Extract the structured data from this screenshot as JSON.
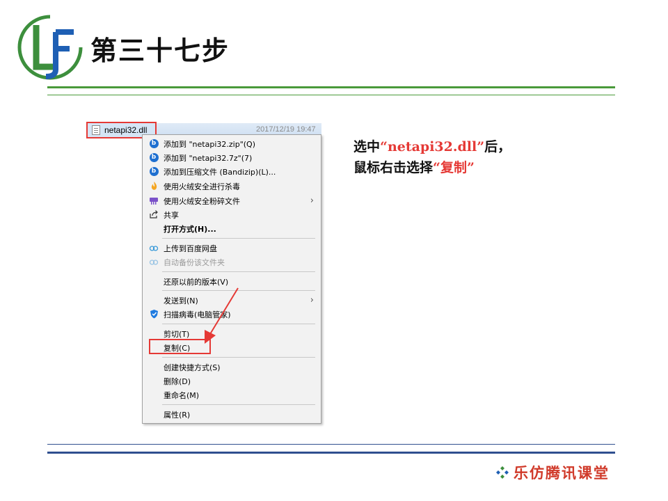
{
  "slide": {
    "title": "第三十七步"
  },
  "file": {
    "name": "netapi32.dll",
    "date": "2017/12/19 19:47"
  },
  "context_menu": {
    "items": [
      {
        "label": "添加到 \"netapi32.zip\"(Q)",
        "icon": "bandizip-icon"
      },
      {
        "label": "添加到 \"netapi32.7z\"(7)",
        "icon": "bandizip-icon"
      },
      {
        "label": "添加到压缩文件 (Bandizip)(L)...",
        "icon": "bandizip-icon"
      },
      {
        "label": "使用火绒安全进行杀毒",
        "icon": "huorong-icon"
      },
      {
        "label": "使用火绒安全粉碎文件",
        "icon": "shredder-icon"
      },
      {
        "label": "共享",
        "icon": "share-icon"
      },
      {
        "label": "打开方式(H)..."
      },
      {
        "label": "上传到百度网盘",
        "icon": "baidu-cloud-icon"
      },
      {
        "label": "自动备份该文件夹",
        "icon": "baidu-cloud-icon"
      },
      {
        "label": "还原以前的版本(V)"
      },
      {
        "label": "发送到(N)"
      },
      {
        "label": "扫描病毒(电脑管家)",
        "icon": "tencent-shield-icon"
      },
      {
        "label": "剪切(T)"
      },
      {
        "label": "复制(C)"
      },
      {
        "label": "创建快捷方式(S)"
      },
      {
        "label": "删除(D)"
      },
      {
        "label": "重命名(M)"
      },
      {
        "label": "属性(R)"
      }
    ],
    "submenu_arrow": "›"
  },
  "instructions": {
    "line1_prefix": "选中",
    "line1_highlight": "“netapi32.dll”",
    "line1_suffix": "后，",
    "line2_prefix": "鼠标右击选择",
    "line2_highlight": "“复制”"
  },
  "footer": {
    "brand": "乐仿腾讯课堂"
  },
  "colors": {
    "accent_red": "#e53935",
    "rule_green": "#4a9a3a",
    "rule_blue": "#2f4f8f",
    "brand_red": "#d03a2a"
  }
}
